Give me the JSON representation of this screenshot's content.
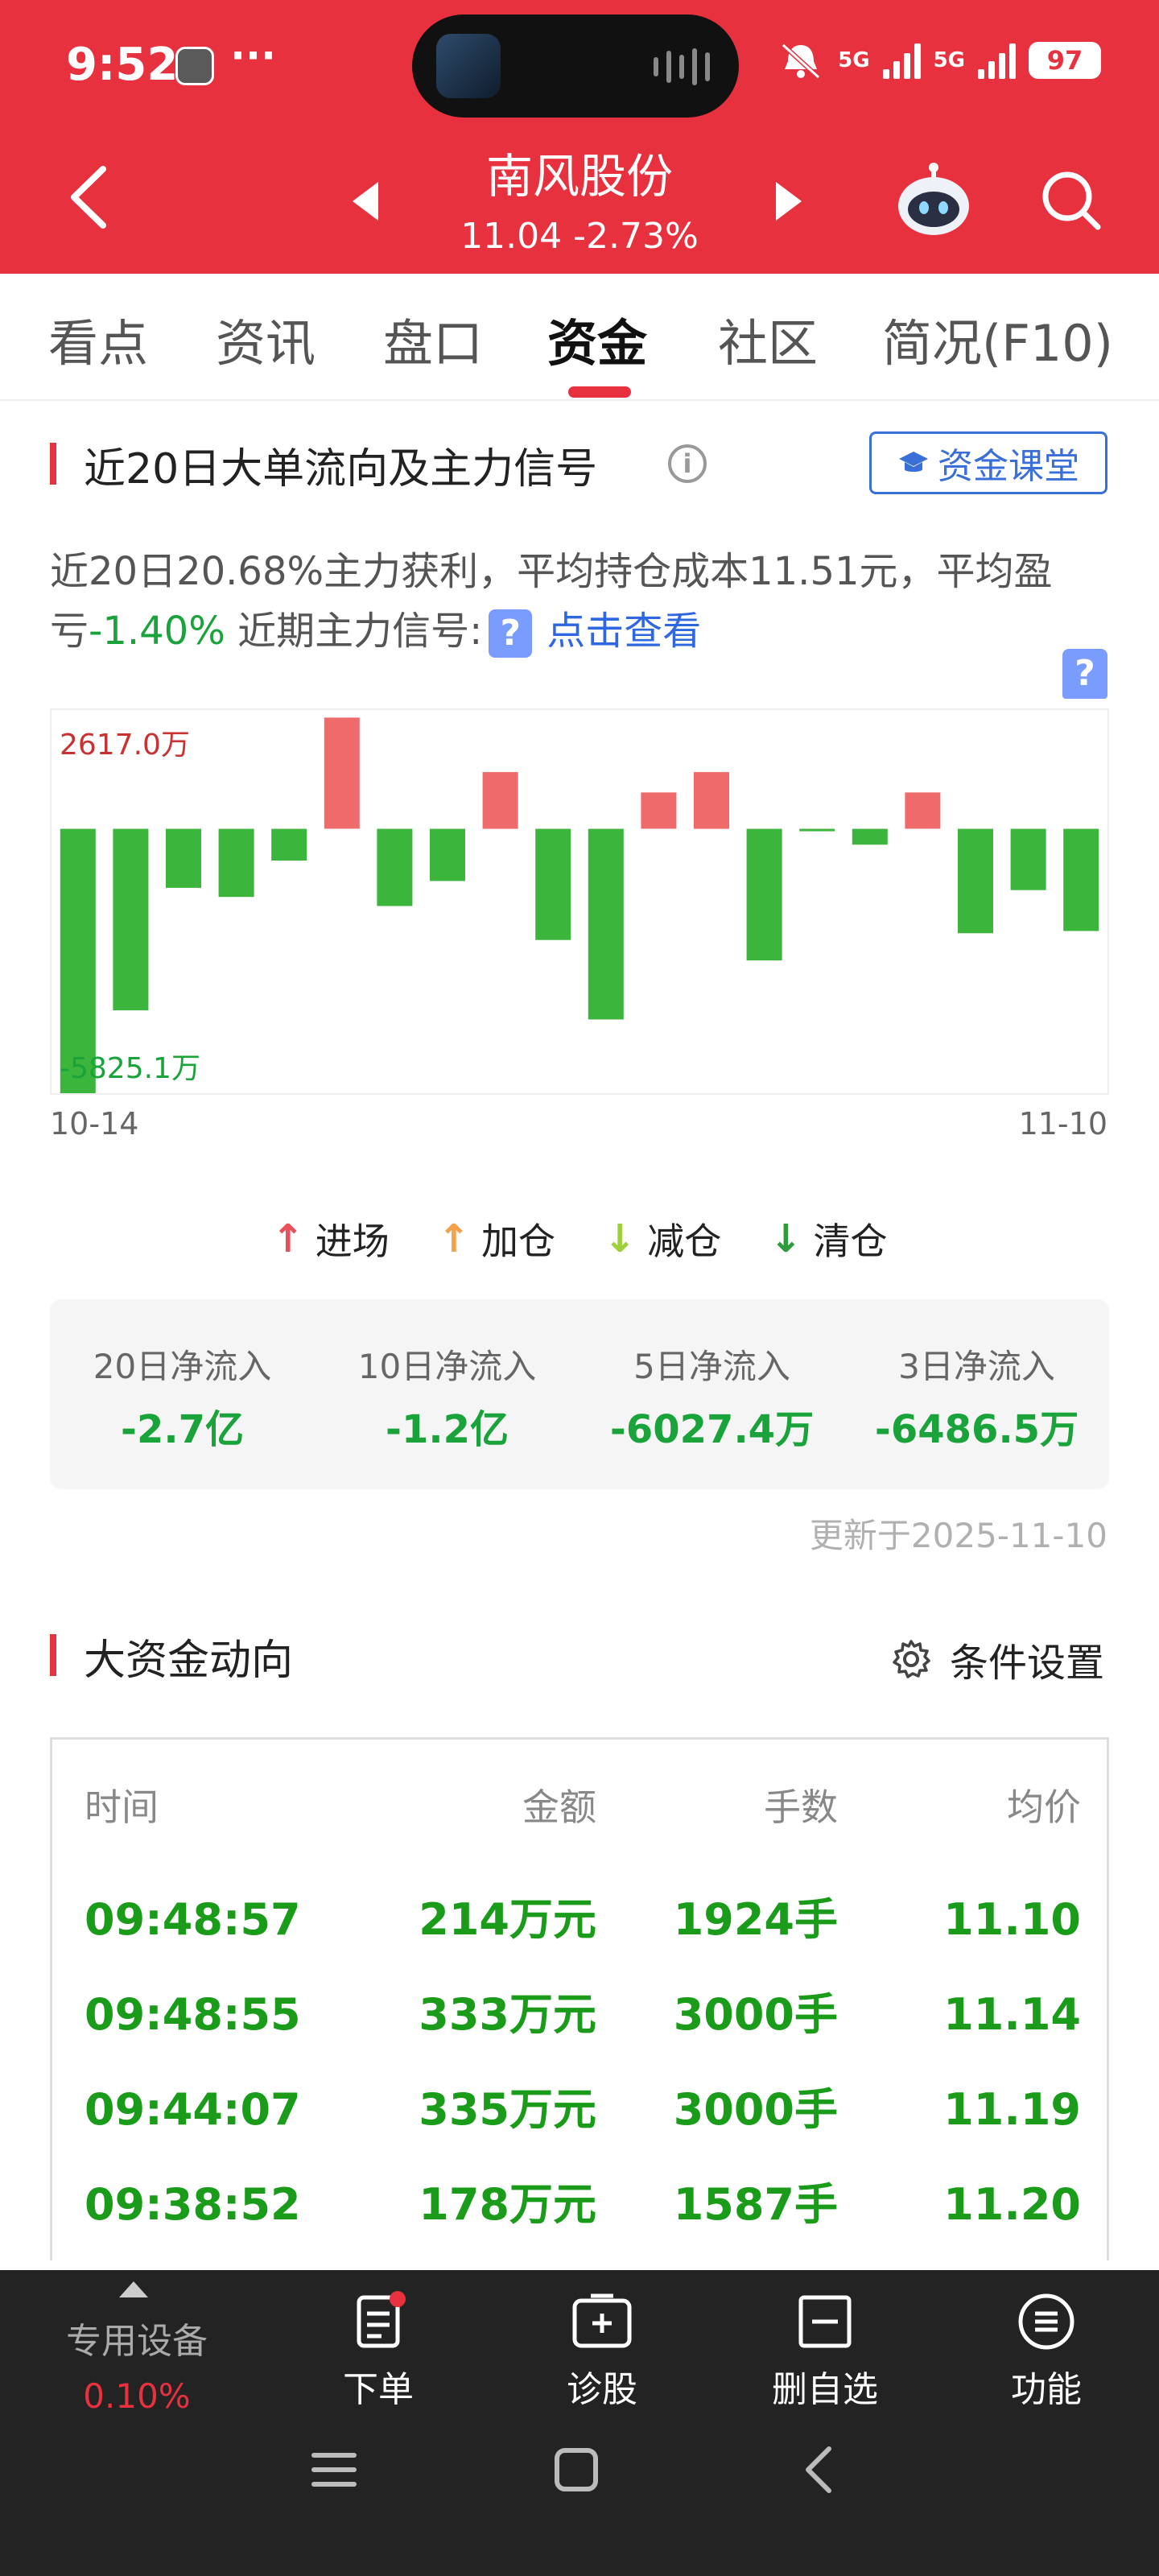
{
  "status_bar": {
    "time": "9:52",
    "dots": "···",
    "net1": "5G",
    "net2": "5G",
    "battery": "97"
  },
  "header": {
    "stock_name": "南风股份",
    "stock_price": "11.04 -2.73%"
  },
  "tabs": [
    {
      "label": "看点",
      "active": false
    },
    {
      "label": "资讯",
      "active": false
    },
    {
      "label": "盘口",
      "active": false
    },
    {
      "label": "资金",
      "active": true
    },
    {
      "label": "社区",
      "active": false
    },
    {
      "label": "简况(F10)",
      "active": false
    }
  ],
  "flow_section": {
    "title": "近20日大单流向及主力信号",
    "course_button": "资金课堂",
    "summary_line1": "近20日20.68%主力获利，平均持仓成本11.51元，平均盈",
    "summary_line2_prefix": "亏",
    "summary_line2_value": "-1.40%",
    "summary_line2_signal": " 近期主力信号:",
    "signal_link": "点击查看",
    "question_icon": "?"
  },
  "chart_data": {
    "type": "bar",
    "max_label": "2617.0万",
    "min_label": "-5825.1万",
    "ylim": [
      -5825.1,
      2617.0
    ],
    "date_start": "10-14",
    "date_end": "11-10",
    "values": [
      -5825.1,
      -4000,
      -1300,
      -1500,
      -700,
      2450,
      -1700,
      -1150,
      1250,
      -2450,
      -4200,
      800,
      1250,
      -2900,
      -30,
      -350,
      800,
      -2300,
      -1350,
      -2250
    ],
    "positive_color": "#ef6b6b",
    "negative_color": "#3cb53c"
  },
  "legend": [
    {
      "label": "进场",
      "arrow": "↑",
      "color": "#e8505b"
    },
    {
      "label": "加仓",
      "arrow": "↑",
      "color": "#f5a04a"
    },
    {
      "label": "减仓",
      "arrow": "↓",
      "color": "#9ed03a"
    },
    {
      "label": "清仓",
      "arrow": "↓",
      "color": "#2f9b3f"
    }
  ],
  "net_flows": [
    {
      "label": "20日净流入",
      "value": "-2.7亿"
    },
    {
      "label": "10日净流入",
      "value": "-1.2亿"
    },
    {
      "label": "5日净流入",
      "value": "-6027.4万"
    },
    {
      "label": "3日净流入",
      "value": "-6486.5万"
    }
  ],
  "updated": "更新于2025-11-10",
  "big_money": {
    "title": "大资金动向",
    "settings_label": "条件设置",
    "headers": [
      "时间",
      "金额",
      "手数",
      "均价"
    ],
    "rows": [
      [
        "09:48:57",
        "214万元",
        "1924手",
        "11.10"
      ],
      [
        "09:48:55",
        "333万元",
        "3000手",
        "11.14"
      ],
      [
        "09:44:07",
        "335万元",
        "3000手",
        "11.19"
      ],
      [
        "09:38:52",
        "178万元",
        "1587手",
        "11.20"
      ]
    ]
  },
  "bottom_bar": {
    "device_label": "专用设备",
    "device_value": "0.10%",
    "order": "下单",
    "diagnose": "诊股",
    "remove_watch": "删自选",
    "functions": "功能"
  }
}
